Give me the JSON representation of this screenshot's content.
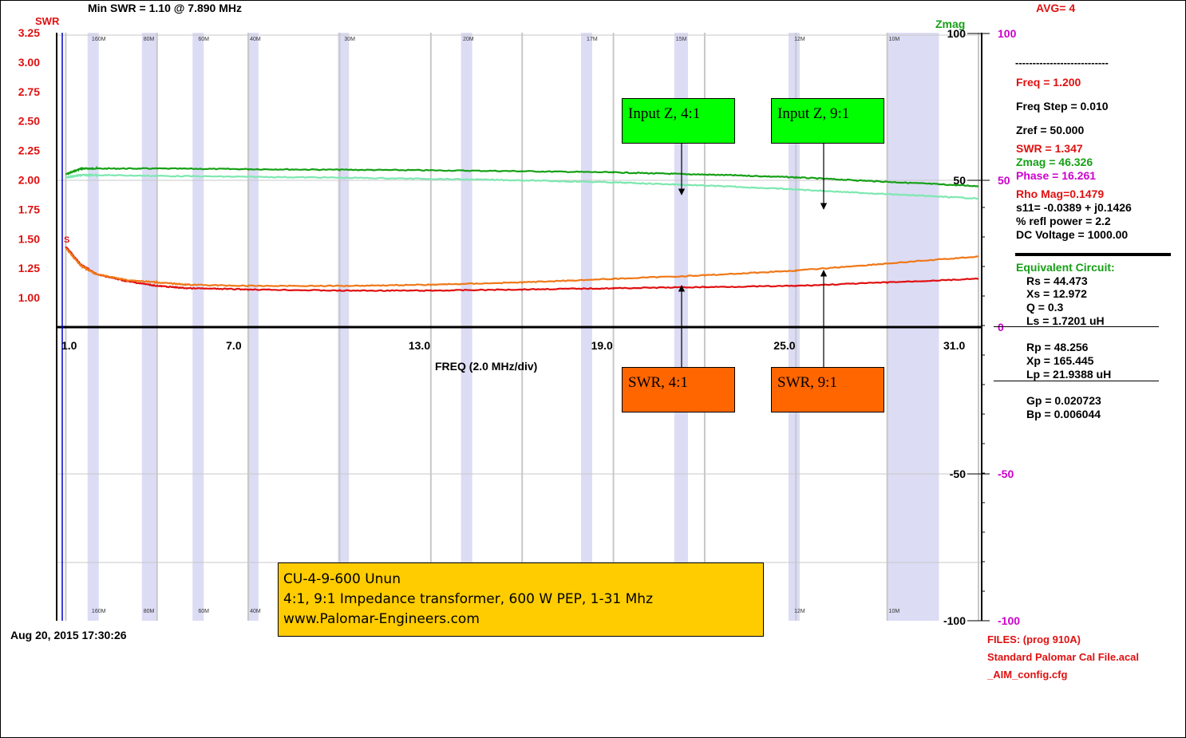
{
  "header": {
    "min_swr": "Min SWR =  1.10 @  7.890 MHz",
    "avg": "AVG=  4",
    "swr_axis_title": "SWR",
    "zmag_axis_title": "Zmag"
  },
  "axes": {
    "swr_ticks": [
      "3.25",
      "3.00",
      "2.75",
      "2.50",
      "2.25",
      "2.00",
      "1.75",
      "1.50",
      "1.25",
      "1.00"
    ],
    "zmag_ticks": [
      "100",
      "50",
      "-50",
      "-100"
    ],
    "phase_ticks": [
      "100",
      "50",
      "0",
      "-50",
      "-100"
    ],
    "freq_ticks": [
      "1.0",
      "7.0",
      "13.0",
      "19.0",
      "25.0",
      "31.0"
    ],
    "freq_label": "FREQ (2.0 MHz/div)"
  },
  "bands": [
    {
      "label": "160M",
      "f0": 1.8,
      "f1": 2.0
    },
    {
      "label": "80M",
      "f0": 3.5,
      "f1": 4.0
    },
    {
      "label": "60M",
      "f0": 5.3,
      "f1": 5.4
    },
    {
      "label": "40M",
      "f0": 7.0,
      "f1": 7.3
    },
    {
      "label": "30M",
      "f0": 10.1,
      "f1": 10.15
    },
    {
      "label": "20M",
      "f0": 14.0,
      "f1": 14.35
    },
    {
      "label": "17M",
      "f0": 18.068,
      "f1": 18.168
    },
    {
      "label": "15M",
      "f0": 21.0,
      "f1": 21.45
    },
    {
      "label": "12M",
      "f0": 24.89,
      "f1": 24.99
    },
    {
      "label": "10M",
      "f0": 28.0,
      "f1": 29.7
    }
  ],
  "band_labels_top": [
    "160M",
    "80M",
    "60M",
    "40M",
    "30M",
    "20M",
    "17M",
    "15M",
    "12M",
    "10M"
  ],
  "band_labels_bottom": [
    "160M",
    "80M",
    "60M",
    "40M",
    "12M",
    "10M"
  ],
  "marker_label": "S",
  "chart_data": {
    "type": "line",
    "x_unit": "MHz",
    "xlim": [
      1.0,
      31.0
    ],
    "swr_ylim": [
      0.75,
      3.25
    ],
    "zmag_ylim": [
      -100,
      100
    ],
    "series": [
      {
        "name": "Input Z, 4:1",
        "axis": "zmag",
        "color": "#16a016",
        "x": [
          1.0,
          1.5,
          2.0,
          4.0,
          7.0,
          10.0,
          13.0,
          16.0,
          19.0,
          21.0,
          23.0,
          25.0,
          27.0,
          29.0,
          31.0
        ],
        "y": [
          52,
          54,
          54,
          54,
          53.8,
          53.6,
          53.4,
          53.1,
          52.7,
          52.2,
          51.7,
          51.0,
          50.0,
          49.0,
          48.0
        ]
      },
      {
        "name": "Input Z, 9:1",
        "axis": "zmag",
        "color": "#7de8b0",
        "x": [
          1.0,
          1.5,
          2.0,
          4.0,
          7.0,
          10.0,
          13.0,
          16.0,
          19.0,
          21.0,
          23.0,
          25.0,
          27.0,
          29.0,
          31.0
        ],
        "y": [
          51,
          51.8,
          51.8,
          51.5,
          51.2,
          50.9,
          50.5,
          50.0,
          49.3,
          48.6,
          47.8,
          46.9,
          45.8,
          44.8,
          43.8
        ]
      },
      {
        "name": "SWR, 4:1",
        "axis": "swr",
        "color": "#e01010",
        "x": [
          1.0,
          1.5,
          2.0,
          3.0,
          4.0,
          5.0,
          7.0,
          10.0,
          13.0,
          16.0,
          19.0,
          22.0,
          25.0,
          28.0,
          31.0
        ],
        "y": [
          1.43,
          1.28,
          1.2,
          1.14,
          1.1,
          1.08,
          1.07,
          1.06,
          1.06,
          1.07,
          1.08,
          1.09,
          1.1,
          1.13,
          1.16
        ]
      },
      {
        "name": "SWR, 9:1",
        "axis": "swr",
        "color": "#f07818",
        "x": [
          1.0,
          1.5,
          2.0,
          3.0,
          4.0,
          5.0,
          7.0,
          10.0,
          13.0,
          16.0,
          19.0,
          22.0,
          25.0,
          28.0,
          31.0
        ],
        "y": [
          1.42,
          1.27,
          1.2,
          1.15,
          1.13,
          1.11,
          1.1,
          1.1,
          1.11,
          1.13,
          1.16,
          1.19,
          1.23,
          1.29,
          1.35
        ]
      }
    ]
  },
  "callouts": [
    {
      "label": "Input Z, 4:1",
      "color": "#00ff00"
    },
    {
      "label": "Input Z, 9:1",
      "color": "#00ff00"
    },
    {
      "label": "SWR, 4:1",
      "color": "#ff6600"
    },
    {
      "label": "SWR, 9:1",
      "color": "#ff6600"
    }
  ],
  "readout": {
    "dashes": "---------------------------",
    "freq": "Freq = 1.200",
    "freq_step": "Freq Step = 0.010",
    "zref": "Zref =   50.000",
    "swr": "SWR  =    1.347",
    "zmag": "Zmag =   46.326",
    "phase": "Phase =   16.261",
    "rho": "Rho Mag=0.1479",
    "s11": "s11= -0.0389 + j0.1426",
    "refl": "% refl power =  2.2",
    "dcv": "DC Voltage =  1000.00",
    "eq_title": "Equivalent Circuit:",
    "rs": "Rs  =   44.473",
    "xs": "Xs  =   12.972",
    "q": "Q  =  0.3",
    "ls": "Ls  =     1.7201  uH",
    "rp": "Rp  =   48.256",
    "xp": "Xp  =  165.445",
    "lp": "Lp  =   21.9388  uH",
    "gp": "Gp  =  0.020723",
    "bp": "Bp  =  0.006044"
  },
  "footer": {
    "date": "Aug 20, 2015  17:30:26",
    "files1": "FILES:  (prog 910A)",
    "files2": "Standard  Palomar  Cal  File.acal",
    "files3": "_AIM_config.cfg"
  },
  "note": {
    "line1": "CU-4-9-600 Unun",
    "line2": "4:1, 9:1 Impedance transformer, 600 W PEP, 1-31 Mhz",
    "line3": "www.Palomar-Engineers.com"
  },
  "colors": {
    "swr_axis": "#e01010",
    "zmag_axis": "#16a016",
    "phase_axis": "#cc00cc",
    "band": "#dcdcf5",
    "grid": "#c8c8c8"
  }
}
